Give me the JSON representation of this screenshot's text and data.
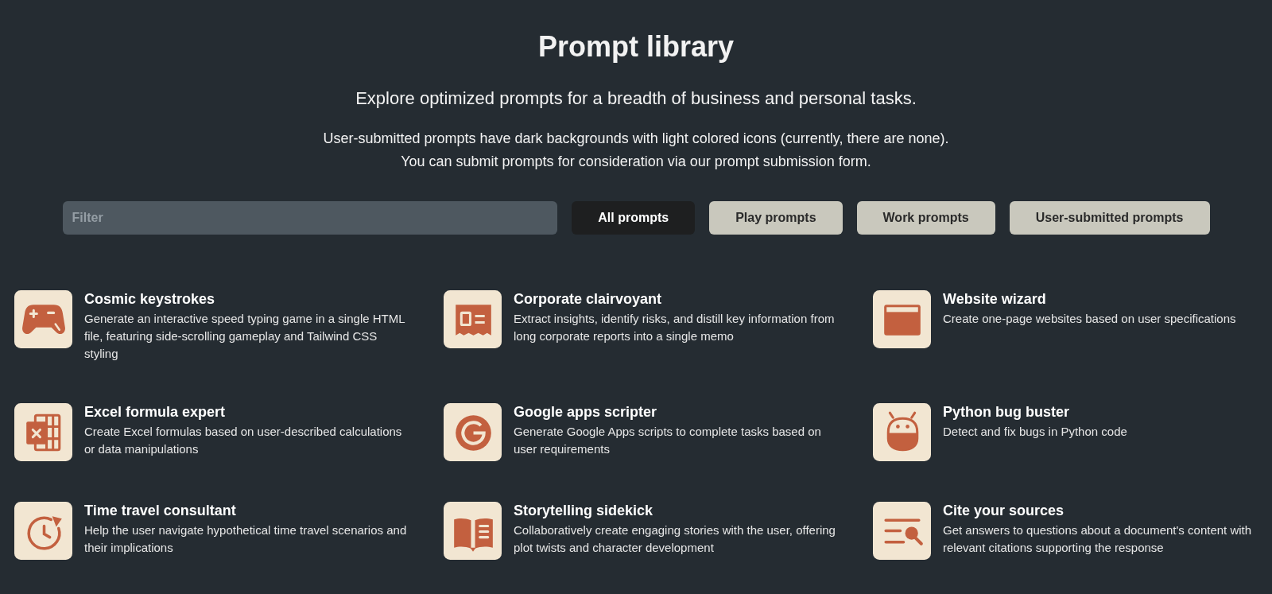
{
  "header": {
    "title": "Prompt library",
    "subtitle": "Explore optimized prompts for a breadth of business and personal tasks.",
    "notes": [
      "User-submitted prompts have dark backgrounds with light colored icons (currently, there are none).",
      "You can submit prompts for consideration via our prompt submission form."
    ]
  },
  "filter": {
    "placeholder": "Filter"
  },
  "tabs": [
    {
      "label": "All prompts",
      "selected": true
    },
    {
      "label": "Play prompts",
      "selected": false
    },
    {
      "label": "Work prompts",
      "selected": false
    },
    {
      "label": "User-submitted prompts",
      "selected": false
    }
  ],
  "prompts": [
    {
      "title": "Cosmic keystrokes",
      "description": "Generate an interactive speed typing game in a single HTML file, featuring side-scrolling gameplay and Tailwind CSS styling"
    },
    {
      "title": "Corporate clairvoyant",
      "description": "Extract insights, identify risks, and distill key information from long corporate reports into a single memo"
    },
    {
      "title": "Website wizard",
      "description": "Create one-page websites based on user specifications"
    },
    {
      "title": "Excel formula expert",
      "description": "Create Excel formulas based on user-described calculations or data manipulations"
    },
    {
      "title": "Google apps scripter",
      "description": "Generate Google Apps scripts to complete tasks based on user requirements"
    },
    {
      "title": "Python bug buster",
      "description": "Detect and fix bugs in Python code"
    },
    {
      "title": "Time travel consultant",
      "description": "Help the user navigate hypothetical time travel scenarios and their implications"
    },
    {
      "title": "Storytelling sidekick",
      "description": "Collaboratively create engaging stories with the user, offering plot twists and character development"
    },
    {
      "title": "Cite your sources",
      "description": "Get answers to questions about a document's content with relevant citations supporting the response"
    }
  ]
}
